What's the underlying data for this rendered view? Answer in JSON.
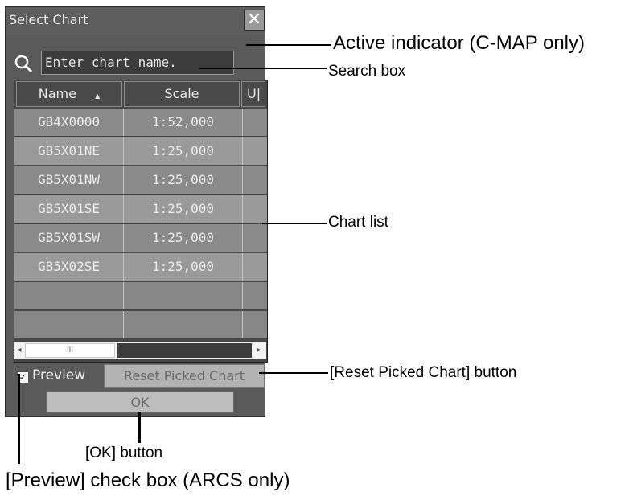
{
  "dialog": {
    "title": "Select Chart",
    "close_label": "✕",
    "search": {
      "value": "Enter chart name."
    },
    "columns": [
      {
        "label": "Name",
        "sort_indicator": "▲"
      },
      {
        "label": "Scale"
      },
      {
        "label": "U|"
      }
    ],
    "rows": [
      {
        "name": "GB4X0000",
        "scale": "1:52,000"
      },
      {
        "name": "GB5X01NE",
        "scale": "1:25,000"
      },
      {
        "name": "GB5X01NW",
        "scale": "1:25,000"
      },
      {
        "name": "GB5X01SE",
        "scale": "1:25,000"
      },
      {
        "name": "GB5X01SW",
        "scale": "1:25,000"
      },
      {
        "name": "GB5X02SE",
        "scale": "1:25,000"
      },
      {
        "name": "",
        "scale": ""
      },
      {
        "name": "",
        "scale": ""
      }
    ],
    "scrollbar": {
      "left": "◂",
      "right": "▸",
      "thumb": "III"
    },
    "preview": {
      "label": "Preview",
      "checked": true
    },
    "reset_button": "Reset Picked Chart",
    "ok_button": "OK"
  },
  "callouts": {
    "active_indicator": "Active indicator (C-MAP only)",
    "search_box": "Search box",
    "chart_list": "Chart list",
    "reset_button": "[Reset Picked Chart] button",
    "ok_button": "[OK] button",
    "preview_checkbox": "[Preview] check box (ARCS only)"
  },
  "colors": {
    "dialog_bg": "#5a5a5a",
    "row_odd": "#8a8a8a",
    "row_even": "#9a9a9a",
    "button_bg": "#b3b3b3"
  }
}
